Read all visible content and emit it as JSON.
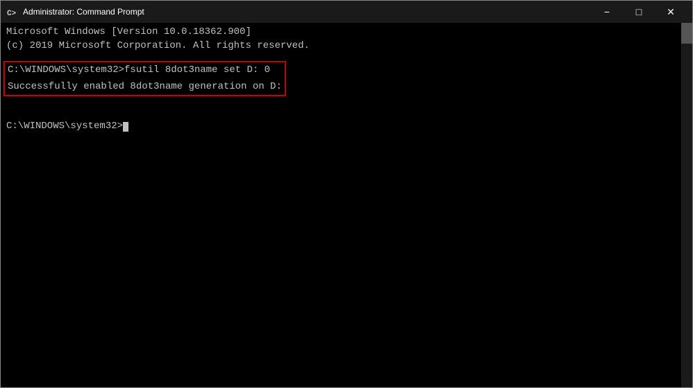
{
  "window": {
    "title": "Administrator: Command Prompt",
    "icon": "cmd-icon"
  },
  "titlebar": {
    "minimize_label": "−",
    "maximize_label": "□",
    "close_label": "✕"
  },
  "terminal": {
    "line1": "Microsoft Windows [Version 10.0.18362.900]",
    "line2": "(c) 2019 Microsoft Corporation. All rights reserved.",
    "line3": "",
    "highlighted_line1": "C:\\WINDOWS\\system32>fsutil 8dot3name set D: 0",
    "highlighted_line2": "Successfully enabled 8dot3name generation on D:",
    "line6": "",
    "prompt_line": "C:\\WINDOWS\\system32>"
  }
}
